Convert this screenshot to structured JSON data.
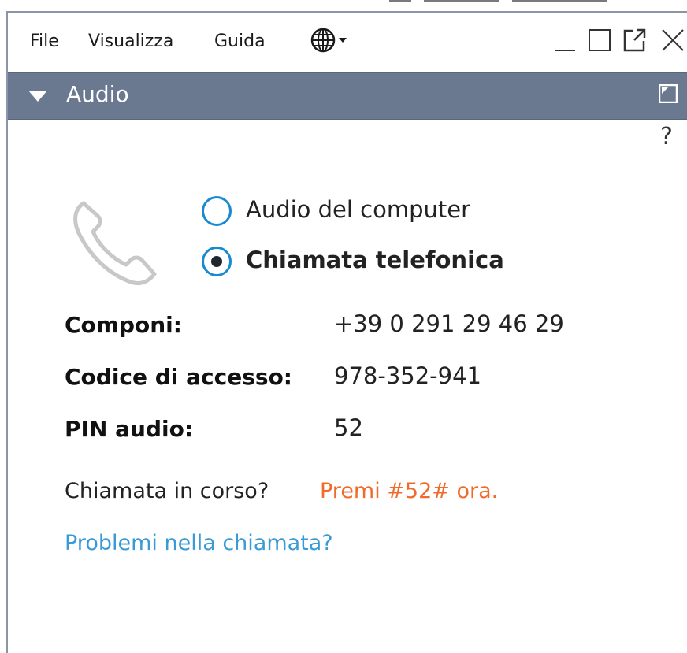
{
  "menubar": {
    "items": [
      "File",
      "Visualizza",
      "Guida"
    ],
    "language_icon": "globe-icon",
    "window_controls": [
      "minimize-icon",
      "maximize-icon",
      "popout-icon",
      "close-icon"
    ]
  },
  "panel": {
    "title": "Audio",
    "help": "?"
  },
  "audio_options": [
    {
      "label": "Audio del computer",
      "selected": false
    },
    {
      "label": "Chiamata telefonica",
      "selected": true
    }
  ],
  "details": {
    "dial_label": "Componi:",
    "dial_value": "+39 0 291 29 46 29",
    "access_label": "Codice di accesso:",
    "access_value": "978-352-941",
    "pin_label": "PIN audio:",
    "pin_value": "52"
  },
  "call": {
    "question": "Chiamata in corso?",
    "action": "Premi #52# ora.",
    "problem_link": "Problemi nella chiamata?"
  },
  "colors": {
    "header_bg": "#6a7890",
    "radio_accent": "#1a8ad0",
    "action_orange": "#f26a2a",
    "link_blue": "#3a9ad6"
  }
}
